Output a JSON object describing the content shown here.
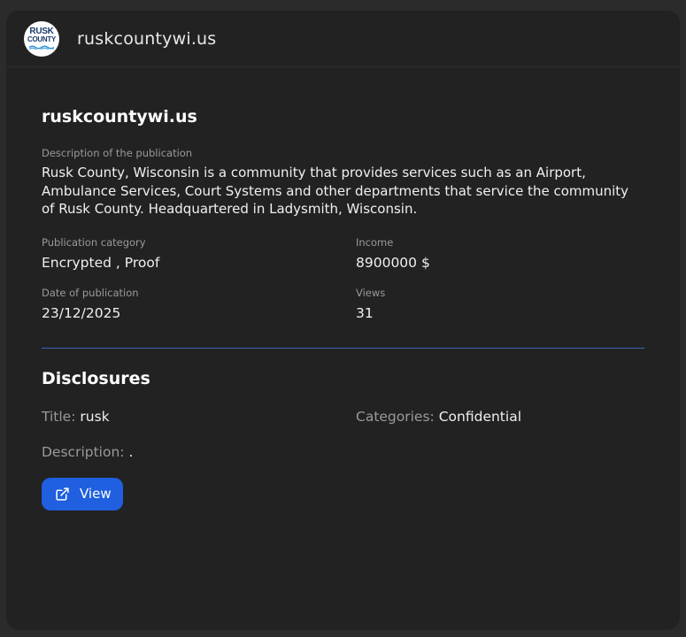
{
  "header": {
    "logo": {
      "line1": "RUSK",
      "line2": "COUNTY"
    },
    "site_name": "ruskcountywi.us"
  },
  "publication": {
    "title": "ruskcountywi.us",
    "description_label": "Description of the publication",
    "description": "Rusk County, Wisconsin is a community that provides services such as an Airport, Ambulance Services, Court Systems and other departments that service the community of Rusk County. Headquartered in Ladysmith, Wisconsin.",
    "category_label": "Publication category",
    "category": "Encrypted , Proof",
    "income_label": "Income",
    "income": "8900000 $",
    "date_label": "Date of publication",
    "date": "23/12/2025",
    "views_label": "Views",
    "views": "31"
  },
  "disclosures": {
    "heading": "Disclosures",
    "title_key": "Title:",
    "title_value": "rusk",
    "categories_key": "Categories:",
    "categories_value": "Confidential",
    "description_key": "Description:",
    "description_value": ".",
    "view_button": "View",
    "view_icon": "external-link-icon"
  },
  "colors": {
    "background": "#2b2b2b",
    "card": "#222222",
    "accent": "#1f5fe0",
    "divider": "#3f66b8",
    "muted_text": "#9a9a9a"
  }
}
